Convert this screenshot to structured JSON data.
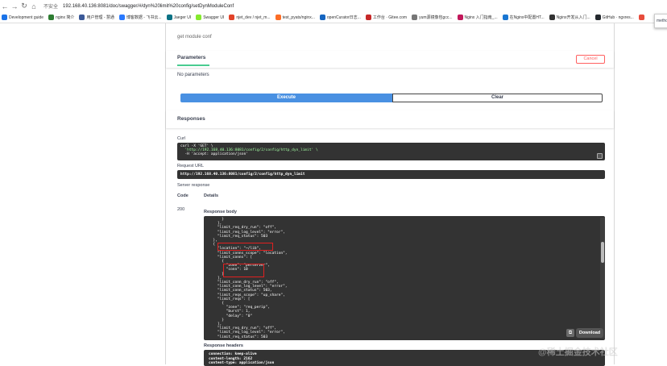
{
  "browser": {
    "back": "←",
    "forward": "→",
    "reload": "↻",
    "home": "⌂",
    "security": "不安全",
    "url": "192.168.40.136:8081/doc/swagger/#/dyn%20limit%20config/setDynModuleConf"
  },
  "bookmarks": [
    {
      "label": "Development guide",
      "color": "#1a73e8"
    },
    {
      "label": "nginx 简介",
      "color": "#2e7d32"
    },
    {
      "label": "用户管理 - 慧通",
      "color": "#3b5998"
    },
    {
      "label": "博客数据 - 飞书云...",
      "color": "#2979ff"
    },
    {
      "label": "Jaeger UI",
      "color": "#0b7285"
    },
    {
      "label": "Swagger UI",
      "color": "#85ea2d"
    },
    {
      "label": "njet_dev / njet_m...",
      "color": "#e24329"
    },
    {
      "label": "test_pyats/nginx...",
      "color": "#fc6d26"
    },
    {
      "label": "openCurator日志...",
      "color": "#1565c0"
    },
    {
      "label": "工作台 · Gitee.com",
      "color": "#c62828"
    },
    {
      "label": "yum源镜像包gcc...",
      "color": "#777777"
    },
    {
      "label": "Nginx 入门指南_...",
      "color": "#c2185b"
    },
    {
      "label": "在Nginx中配置HT...",
      "color": "#1976d2"
    },
    {
      "label": "Nginx开发从入门...",
      "color": "#333333"
    },
    {
      "label": "GitHub · ngxres...",
      "color": "#24292e"
    },
    {
      "label": "",
      "color": "#e74c3c"
    }
  ],
  "corner_tab": "methc",
  "operation": {
    "description": "get module conf",
    "parameters_title": "Parameters",
    "cancel_label": "Cancel",
    "no_parameters": "No parameters",
    "execute_label": "Execute",
    "clear_label": "Clear"
  },
  "responses": {
    "title": "Responses",
    "curl_label": "Curl",
    "curl_lines": [
      {
        "text": "curl -X 'GET' \\",
        "cls": ""
      },
      {
        "text": "  'http://192.168.40.136:8081/config/2/config/http_dyn_limit' \\",
        "cls": "g"
      },
      {
        "text": "  -H 'accept: application/json'",
        "cls": ""
      }
    ],
    "request_url_label": "Request URL",
    "request_url": "http://192.168.40.136:8081/config/2/config/http_dyn_limit",
    "server_response_label": "Server response",
    "code_header": "Code",
    "details_header": "Details",
    "code": "200",
    "response_body_label": "Response body",
    "body_lines": [
      "      }",
      "    ],",
      "    \"limit_req_dry_run\": \"off\",",
      "    \"limit_req_log_level\": \"error\",",
      "    \"limit_req_status\": 503",
      "  },",
      "  {",
      "    \"location\": \"~/lib\",",
      "    \"limit_conns_scope\": \"location\",",
      "    \"limit_conns\": [",
      "      {",
      "        \"zone\": \"perserver\",",
      "        \"conn\": 10",
      "      }",
      "    ],",
      "    \"limit_conn_dry_run\": \"off\",",
      "    \"limit_conn_log_level\": \"error\",",
      "    \"limit_conn_status\": 503,",
      "    \"limit_reqs_scope\": \"up_share\",",
      "    \"limit_reqs\": [",
      "      {",
      "        \"zone\": \"req_perip\",",
      "        \"burst\": 1,",
      "        \"delay\": \"0\"",
      "      }",
      "    ],",
      "    \"limit_req_dry_run\": \"off\",",
      "    \"limit_req_log_level\": \"error\",",
      "    \"limit_req_status\": 503"
    ],
    "download_label": "Download",
    "response_headers_label": "Response headers",
    "header_lines": [
      "connection: keep-alive",
      "content-length: 2162",
      "content-type: application/json"
    ]
  },
  "watermark": "@稀土掘金技术社区"
}
